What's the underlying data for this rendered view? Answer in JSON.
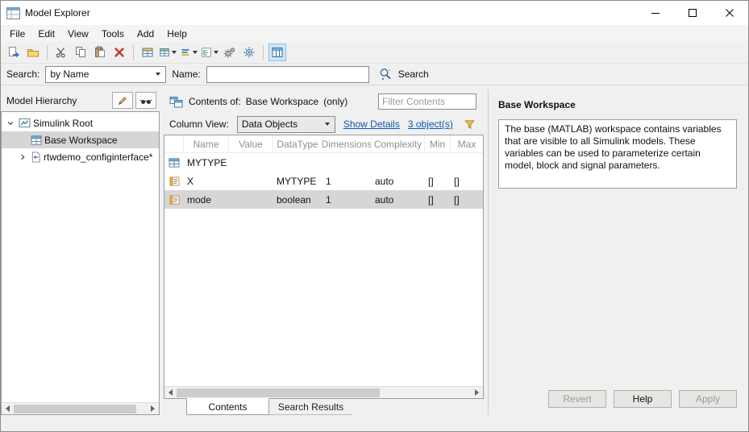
{
  "window": {
    "title": "Model Explorer"
  },
  "menu": {
    "items": [
      "File",
      "Edit",
      "View",
      "Tools",
      "Add",
      "Help"
    ]
  },
  "toolbar": {
    "icons": [
      "new-object-icon",
      "open-icon",
      "cut-icon",
      "copy-icon",
      "paste-icon",
      "delete-icon",
      "add-grid-icon",
      "add-grid-menu-icon",
      "view-list-menu-icon",
      "hierarchy-menu-icon",
      "gears-icon",
      "preferences-icon",
      "dialog-pane-toggle-icon"
    ]
  },
  "search_bar": {
    "search_label": "Search:",
    "mode_value": "by Name",
    "name_label": "Name:",
    "name_value": "",
    "button_label": "Search"
  },
  "hierarchy": {
    "title": "Model Hierarchy",
    "items": [
      {
        "label": "Simulink Root"
      },
      {
        "label": "Base Workspace"
      },
      {
        "label": "rtwdemo_configinterface*"
      }
    ]
  },
  "contents": {
    "header_label": "Contents of:",
    "header_target": "Base Workspace",
    "header_scope": "(only)",
    "filter_placeholder": "Filter Contents",
    "column_view_label": "Column View:",
    "column_view_value": "Data Objects",
    "show_details_link": "Show Details",
    "object_count_link": "3 object(s)",
    "table": {
      "headers": [
        "Name",
        "Value",
        "DataType",
        "Dimensions",
        "Complexity",
        "Min",
        "Max"
      ],
      "rows": [
        {
          "name": "MYTYPE",
          "value": "",
          "datatype": "",
          "dimensions": "",
          "complexity": "",
          "min": "",
          "max": ""
        },
        {
          "name": "X",
          "value": "",
          "datatype": "MYTYPE",
          "dimensions": "1",
          "complexity": "auto",
          "min": "[]",
          "max": "[]"
        },
        {
          "name": "mode",
          "value": "",
          "datatype": "boolean",
          "dimensions": "1",
          "complexity": "auto",
          "min": "[]",
          "max": "[]"
        }
      ]
    },
    "tabs": [
      {
        "label": "Contents"
      },
      {
        "label": "Search Results"
      }
    ]
  },
  "detail": {
    "title": "Base Workspace",
    "description": "The base (MATLAB) workspace contains variables that are visible to all Simulink models. These variables can be used to parameterize certain model, block and signal parameters.",
    "buttons": [
      {
        "label": "Revert",
        "enabled": false
      },
      {
        "label": "Help",
        "enabled": true
      },
      {
        "label": "Apply",
        "enabled": false
      }
    ]
  }
}
